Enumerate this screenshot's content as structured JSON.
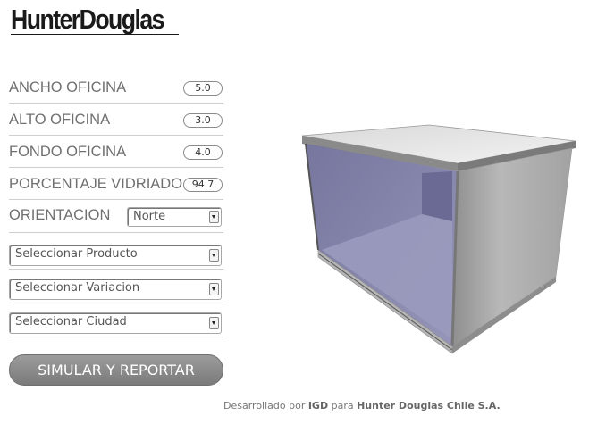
{
  "brand": {
    "logo_text": "HunterDouglas"
  },
  "fields": [
    {
      "label": "ANCHO OFICINA",
      "value": "5.0"
    },
    {
      "label": "ALTO OFICINA",
      "value": "3.0"
    },
    {
      "label": "FONDO OFICINA",
      "value": "4.0"
    },
    {
      "label": "PORCENTAJE VIDRIADO",
      "value": "94.7"
    }
  ],
  "orientacion": {
    "label": "ORIENTACION",
    "selected": "Norte"
  },
  "selects": {
    "producto": "Seleccionar Producto",
    "variacion": "Seleccionar Variacion",
    "ciudad": "Seleccionar Ciudad"
  },
  "actions": {
    "simulate_label": "SIMULAR Y REPORTAR"
  },
  "footer": {
    "prefix": "Desarrollado por ",
    "developer": "IGD",
    "middle": " para ",
    "company": "Hunter Douglas Chile S.A."
  },
  "colors": {
    "glass": "#7f7fa6",
    "frame": "#a9a9a9",
    "button": "#8c8c8c"
  }
}
